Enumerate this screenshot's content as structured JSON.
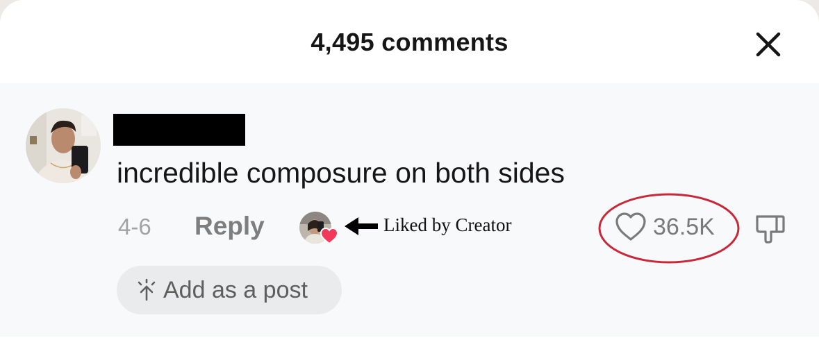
{
  "header": {
    "title": "4,495 comments",
    "close_icon": "close-icon"
  },
  "comment": {
    "author_name": "",
    "author_name_redacted": true,
    "text": "incredible composure on both sides",
    "date": "4-6",
    "reply_label": "Reply",
    "liked_by_creator_label": "Liked by Creator",
    "like_count": "36.5K",
    "add_post_label": "Add as a post"
  },
  "icons": {
    "like": "heart-outline-icon",
    "dislike": "thumbs-down-icon",
    "creator_heart": "heart-filled-icon",
    "arrow": "arrow-left-icon",
    "add_post": "sparkle-arrow-icon"
  },
  "colors": {
    "highlight_circle": "#c8283a",
    "creator_heart": "#f2395a",
    "comment_background": "#f8f9fb"
  }
}
